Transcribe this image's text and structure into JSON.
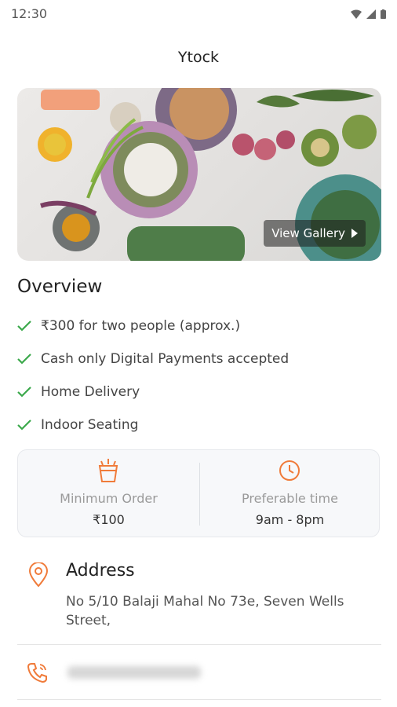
{
  "status_bar": {
    "time": "12:30"
  },
  "app": {
    "title": "Ytock"
  },
  "hero": {
    "view_gallery_label": "View Gallery"
  },
  "overview": {
    "title": "Overview",
    "items": [
      "₹300 for two people (approx.)",
      "Cash only Digital Payments accepted",
      "Home Delivery",
      "Indoor Seating"
    ]
  },
  "info": {
    "min_order": {
      "label": "Minimum Order",
      "value": "₹100"
    },
    "preferable_time": {
      "label": "Preferable time",
      "value": "9am - 8pm"
    }
  },
  "address": {
    "heading": "Address",
    "text": "No 5/10 Balaji Mahal No 73e, Seven Wells Street,"
  },
  "colors": {
    "accent": "#f07b3a",
    "check": "#3aa84a"
  }
}
